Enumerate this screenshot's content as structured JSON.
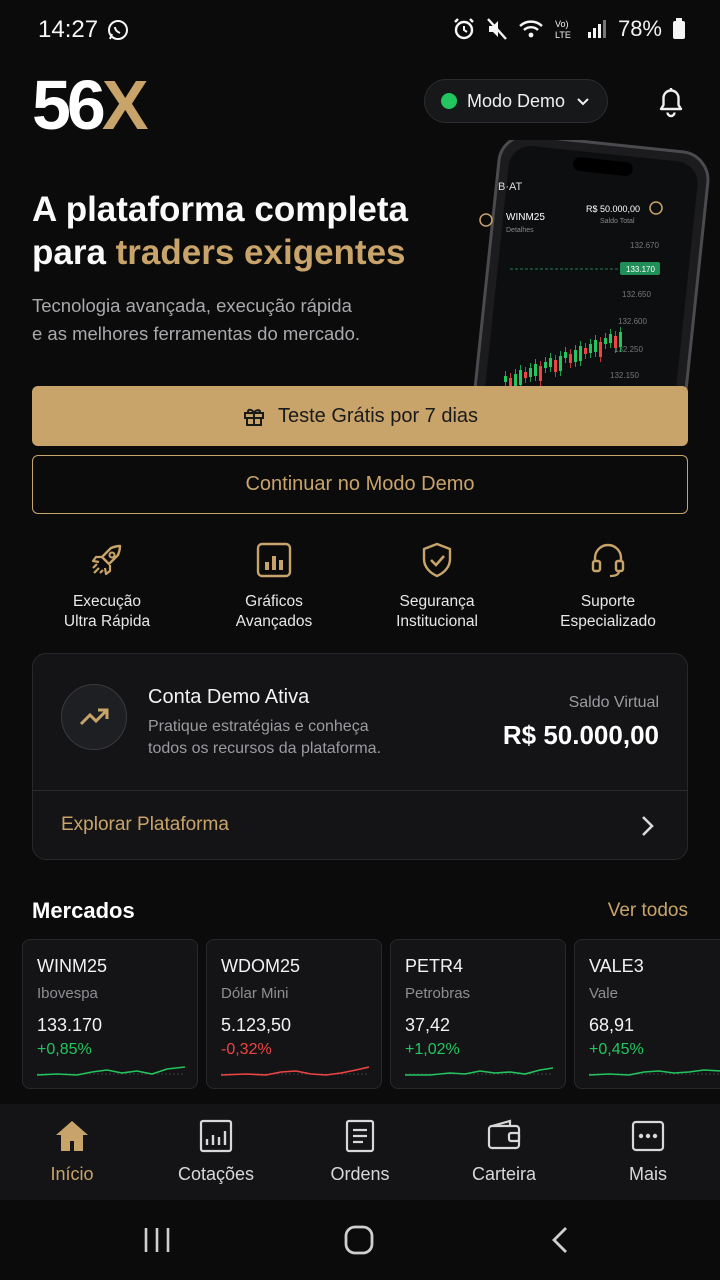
{
  "status_bar": {
    "time": "14:27",
    "battery": "78%",
    "icons": [
      "whatsapp-icon",
      "alarm-icon",
      "mute-icon",
      "wifi-icon",
      "volte-icon",
      "signal-icon",
      "battery-icon"
    ]
  },
  "header": {
    "logo_part1": "56",
    "logo_part2": "X",
    "mode_label": "Modo Demo",
    "mode_status_color": "#22c55e"
  },
  "hero": {
    "title_line1": "A plataforma completa",
    "title_line2_plain": "para ",
    "title_line2_gold": "traders exigentes",
    "subtitle_line1": "Tecnologia avançada, execução rápida",
    "subtitle_line2": "e as melhores ferramentas do mercado."
  },
  "phone_mock": {
    "carrier": "B·AT",
    "symbol": "WINM25",
    "symbol_sub": "Detalhes",
    "balance": "R$ 50.000,00",
    "balance_sub": "Saldo Total",
    "price_badge": "133.170",
    "prices": [
      "132.670",
      "132.650",
      "132.600",
      "132.250",
      "132.150"
    ]
  },
  "buttons": {
    "trial": "Teste Grátis por 7 dias",
    "demo": "Continuar no Modo Demo"
  },
  "features": [
    {
      "icon": "rocket-icon",
      "line1": "Execução",
      "line2": "Ultra Rápida"
    },
    {
      "icon": "chart-bars-icon",
      "line1": "Gráficos",
      "line2": "Avançados"
    },
    {
      "icon": "shield-check-icon",
      "line1": "Segurança",
      "line2": "Institucional"
    },
    {
      "icon": "headset-icon",
      "line1": "Suporte",
      "line2": "Especializado"
    }
  ],
  "demo_card": {
    "title": "Conta Demo Ativa",
    "desc_line1": "Pratique estratégias e conheça",
    "desc_line2": "todos os recursos da plataforma.",
    "saldo_label": "Saldo Virtual",
    "saldo_value": "R$ 50.000,00",
    "explore_label": "Explorar Plataforma"
  },
  "markets": {
    "title": "Mercados",
    "see_all": "Ver todos",
    "items": [
      {
        "symbol": "WINM25",
        "name": "Ibovespa",
        "price": "133.170",
        "change": "+0,85%",
        "trend": "up"
      },
      {
        "symbol": "WDOM25",
        "name": "Dólar Mini",
        "price": "5.123,50",
        "change": "-0,32%",
        "trend": "down"
      },
      {
        "symbol": "PETR4",
        "name": "Petrobras",
        "price": "37,42",
        "change": "+1,02%",
        "trend": "up"
      },
      {
        "symbol": "VALE3",
        "name": "Vale",
        "price": "68,91",
        "change": "+0,45%",
        "trend": "up"
      }
    ]
  },
  "bottom_nav": [
    {
      "label": "Início",
      "icon": "home-icon",
      "active": true
    },
    {
      "label": "Cotações",
      "icon": "quotes-chart-icon",
      "active": false
    },
    {
      "label": "Ordens",
      "icon": "orders-list-icon",
      "active": false
    },
    {
      "label": "Carteira",
      "icon": "wallet-icon",
      "active": false
    },
    {
      "label": "Mais",
      "icon": "more-icon",
      "active": false
    }
  ],
  "colors": {
    "accent_gold": "#c9a46a",
    "positive": "#22c55e",
    "negative": "#ef4444",
    "background": "#0b0b0b"
  }
}
